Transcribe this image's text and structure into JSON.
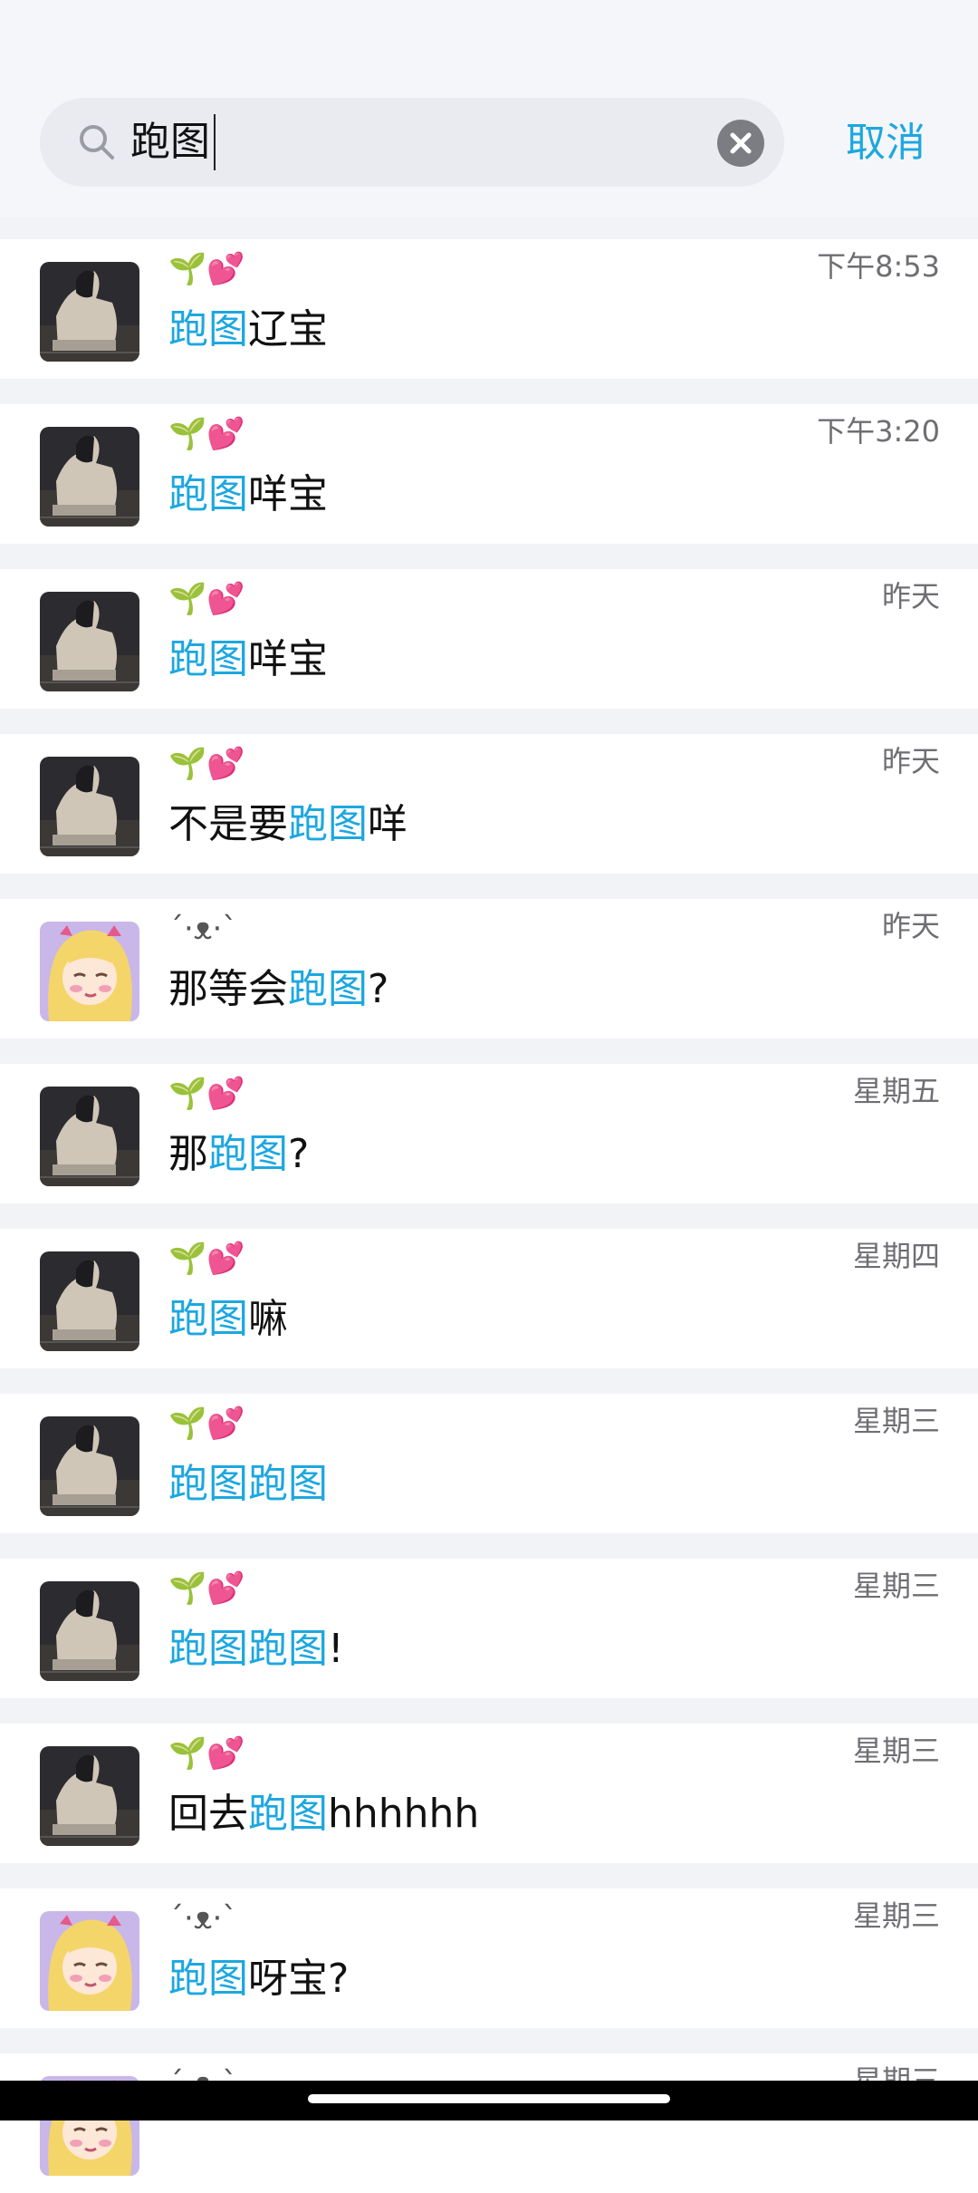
{
  "search": {
    "query": "跑图",
    "cancel_label": "取消"
  },
  "results": [
    {
      "sender": "🌱💕",
      "avatar": "photo",
      "time": "下午8:53",
      "parts": [
        {
          "t": "跑图",
          "h": true
        },
        {
          "t": "辽宝",
          "h": false
        }
      ]
    },
    {
      "sender": "🌱💕",
      "avatar": "photo",
      "time": "下午3:20",
      "parts": [
        {
          "t": "跑图",
          "h": true
        },
        {
          "t": "咩宝",
          "h": false
        }
      ]
    },
    {
      "sender": "🌱💕",
      "avatar": "photo",
      "time": "昨天",
      "parts": [
        {
          "t": "跑图",
          "h": true
        },
        {
          "t": "咩宝",
          "h": false
        }
      ]
    },
    {
      "sender": "🌱💕",
      "avatar": "photo",
      "time": "昨天",
      "parts": [
        {
          "t": "不是要",
          "h": false
        },
        {
          "t": "跑图",
          "h": true
        },
        {
          "t": "咩",
          "h": false
        }
      ]
    },
    {
      "sender": "´·ᴥ·`",
      "avatar": "cartoon",
      "time": "昨天",
      "parts": [
        {
          "t": "那等会",
          "h": false
        },
        {
          "t": "跑图",
          "h": true
        },
        {
          "t": "?",
          "h": false
        }
      ]
    },
    {
      "sender": "🌱💕",
      "avatar": "photo",
      "time": "星期五",
      "parts": [
        {
          "t": "那",
          "h": false
        },
        {
          "t": "跑图",
          "h": true
        },
        {
          "t": "?",
          "h": false
        }
      ]
    },
    {
      "sender": "🌱💕",
      "avatar": "photo",
      "time": "星期四",
      "parts": [
        {
          "t": "跑图",
          "h": true
        },
        {
          "t": "嘛",
          "h": false
        }
      ]
    },
    {
      "sender": "🌱💕",
      "avatar": "photo",
      "time": "星期三",
      "parts": [
        {
          "t": "跑图跑图",
          "h": true
        }
      ]
    },
    {
      "sender": "🌱💕",
      "avatar": "photo",
      "time": "星期三",
      "parts": [
        {
          "t": "跑图跑图",
          "h": true
        },
        {
          "t": "!",
          "h": false
        }
      ]
    },
    {
      "sender": "🌱💕",
      "avatar": "photo",
      "time": "星期三",
      "parts": [
        {
          "t": "回去",
          "h": false
        },
        {
          "t": "跑图",
          "h": true
        },
        {
          "t": "hhhhhh",
          "h": false
        }
      ]
    },
    {
      "sender": "´·ᴥ·`",
      "avatar": "cartoon",
      "time": "星期三",
      "parts": [
        {
          "t": "跑图",
          "h": true
        },
        {
          "t": "呀宝?",
          "h": false
        }
      ]
    },
    {
      "sender": "´·ᴥ·`",
      "avatar": "cartoon",
      "time": "星期三",
      "parts": []
    }
  ]
}
